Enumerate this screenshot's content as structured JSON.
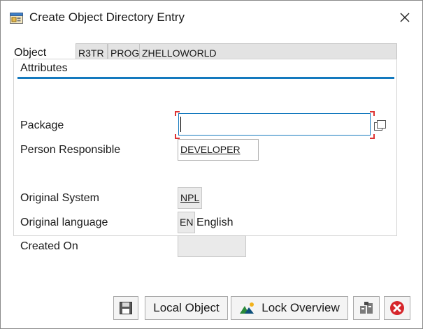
{
  "window": {
    "title": "Create Object Directory Entry"
  },
  "object": {
    "label": "Object",
    "pgmid": "R3TR",
    "type": "PROG",
    "name": "ZHELLOWORLD"
  },
  "attributes": {
    "title": "Attributes",
    "package": {
      "label": "Package",
      "value": ""
    },
    "person_responsible": {
      "label": "Person Responsible",
      "value": "DEVELOPER"
    },
    "original_system": {
      "label": "Original System",
      "value": "NPL"
    },
    "original_language": {
      "label": "Original language",
      "code": "EN",
      "text": "English"
    },
    "created_on": {
      "label": "Created On",
      "value": ""
    }
  },
  "toolbar": {
    "local_object": "Local Object",
    "lock_overview": "Lock Overview"
  },
  "icons": [
    "window-app-icon",
    "close-icon",
    "value-help-icon",
    "save-icon",
    "lock-overview-icon",
    "object-assign-icon",
    "cancel-icon"
  ]
}
